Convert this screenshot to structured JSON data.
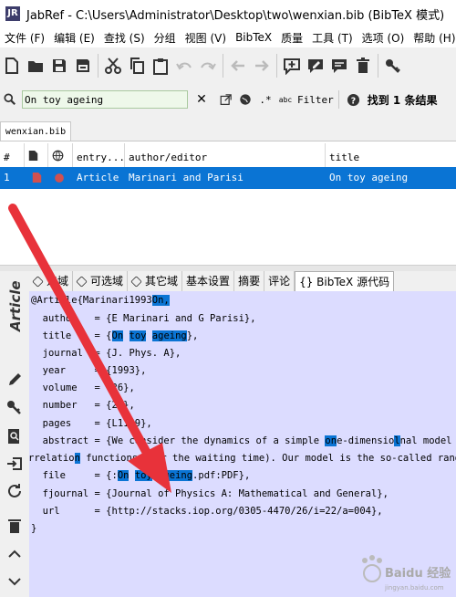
{
  "window": {
    "title": "JabRef - C:\\Users\\Administrator\\Desktop\\two\\wenxian.bib (BibTeX 模式)",
    "logo_text": "JR"
  },
  "menu": [
    "文件 (F)",
    "编辑 (E)",
    "查找 (S)",
    "分组",
    "视图 (V)",
    "BibTeX",
    "质量",
    "工具 (T)",
    "选项 (O)",
    "帮助 (H)"
  ],
  "search": {
    "value": "On toy ageing",
    "filter_label": "Filter",
    "found_text": "找到 1 条结果",
    "regex_label": ".*",
    "case_label": "abc"
  },
  "file_tab": "wenxian.bib",
  "table": {
    "headers": [
      "#",
      "",
      "",
      "entry...",
      "author/editor",
      "title"
    ],
    "row": {
      "num": "1",
      "type": "Article",
      "author": "Marinari and Parisi",
      "title": "On toy ageing"
    }
  },
  "side_panel": {
    "title": "Article"
  },
  "entry_tabs": [
    "选域",
    "可选域",
    "其它域",
    "基本设置",
    "摘要",
    "评论",
    "{} BibTeX 源代码"
  ],
  "source": {
    "l1a": "@Article{Marinari1993",
    "l1b": "On",
    "l1c": ",",
    "author": "  author   = {E Marinari and G Parisi},",
    "title_a": "  title    = {",
    "t_on": "On",
    "t_toy": "toy",
    "t_ageing": "ageing",
    "title_b": "},",
    "journal": "  journal  = {J. Phys. A},",
    "year": "  year     = {1993},",
    "volume": "  volume   = {26},",
    "number": "  number   = {22},",
    "pages": "  pages    = {L1149},",
    "abs_a": "  abstract = {We consider the dynamics of a simple ",
    "abs_on": "on",
    "abs_b": "e-dimensio",
    "abs_c": "nal model and w",
    "cont_a": "rrelatio",
    "cont_on": "n",
    "cont_b": " functions over the waiting time). Our model is the so-called random",
    "file_a": "  file     = {:",
    "f_on": "On",
    "f_toy": "toy",
    "f_ageing": "ageing",
    "file_b": ".pdf:PDF},",
    "fjournal": "  fjournal = {Journal of Physics A: Mathematical and General},",
    "url": "  url      = {http://stacks.iop.org/0305-4470/26/i=22/a=004},",
    "close": "}"
  },
  "watermark": {
    "text": "Baidu 经验",
    "url_text": "jingyan.baidu.com"
  },
  "colors": {
    "selection": "#0a74d4",
    "editor_bg": "#dcdcff",
    "arrow": "#e8323a",
    "search_bg": "#eef8ea"
  }
}
